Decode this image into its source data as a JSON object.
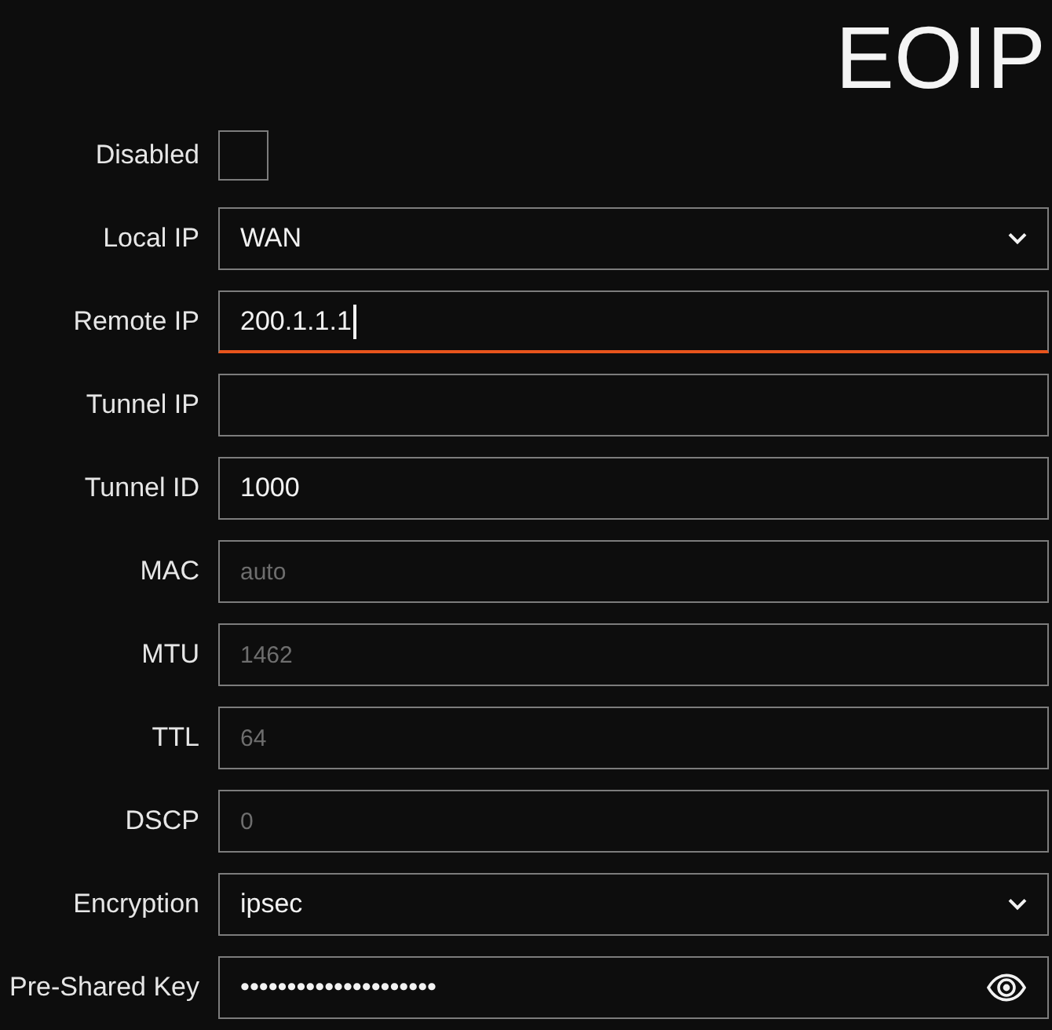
{
  "title": "EOIP",
  "rows": [
    {
      "label": "Disabled",
      "kind": "checkbox",
      "checked": false,
      "focused": false
    },
    {
      "label": "Local IP",
      "kind": "select",
      "value": "WAN",
      "focused": false
    },
    {
      "label": "Remote IP",
      "kind": "text",
      "value": "200.1.1.1",
      "focused": true
    },
    {
      "label": "Tunnel IP",
      "kind": "text",
      "focused": false
    },
    {
      "label": "Tunnel ID",
      "kind": "text",
      "value": "1000",
      "focused": false
    },
    {
      "label": "MAC",
      "kind": "text",
      "placeholder": "auto",
      "focused": false
    },
    {
      "label": "MTU",
      "kind": "text",
      "placeholder": "1462",
      "focused": false
    },
    {
      "label": "TTL",
      "kind": "text",
      "placeholder": "64",
      "focused": false
    },
    {
      "label": "DSCP",
      "kind": "text",
      "placeholder": "0",
      "focused": false
    },
    {
      "label": "Encryption",
      "kind": "select",
      "value": "ipsec",
      "focused": false
    },
    {
      "label": "Pre-Shared Key",
      "kind": "password",
      "value": "•••••••••••••••••••••",
      "focused": false
    }
  ]
}
